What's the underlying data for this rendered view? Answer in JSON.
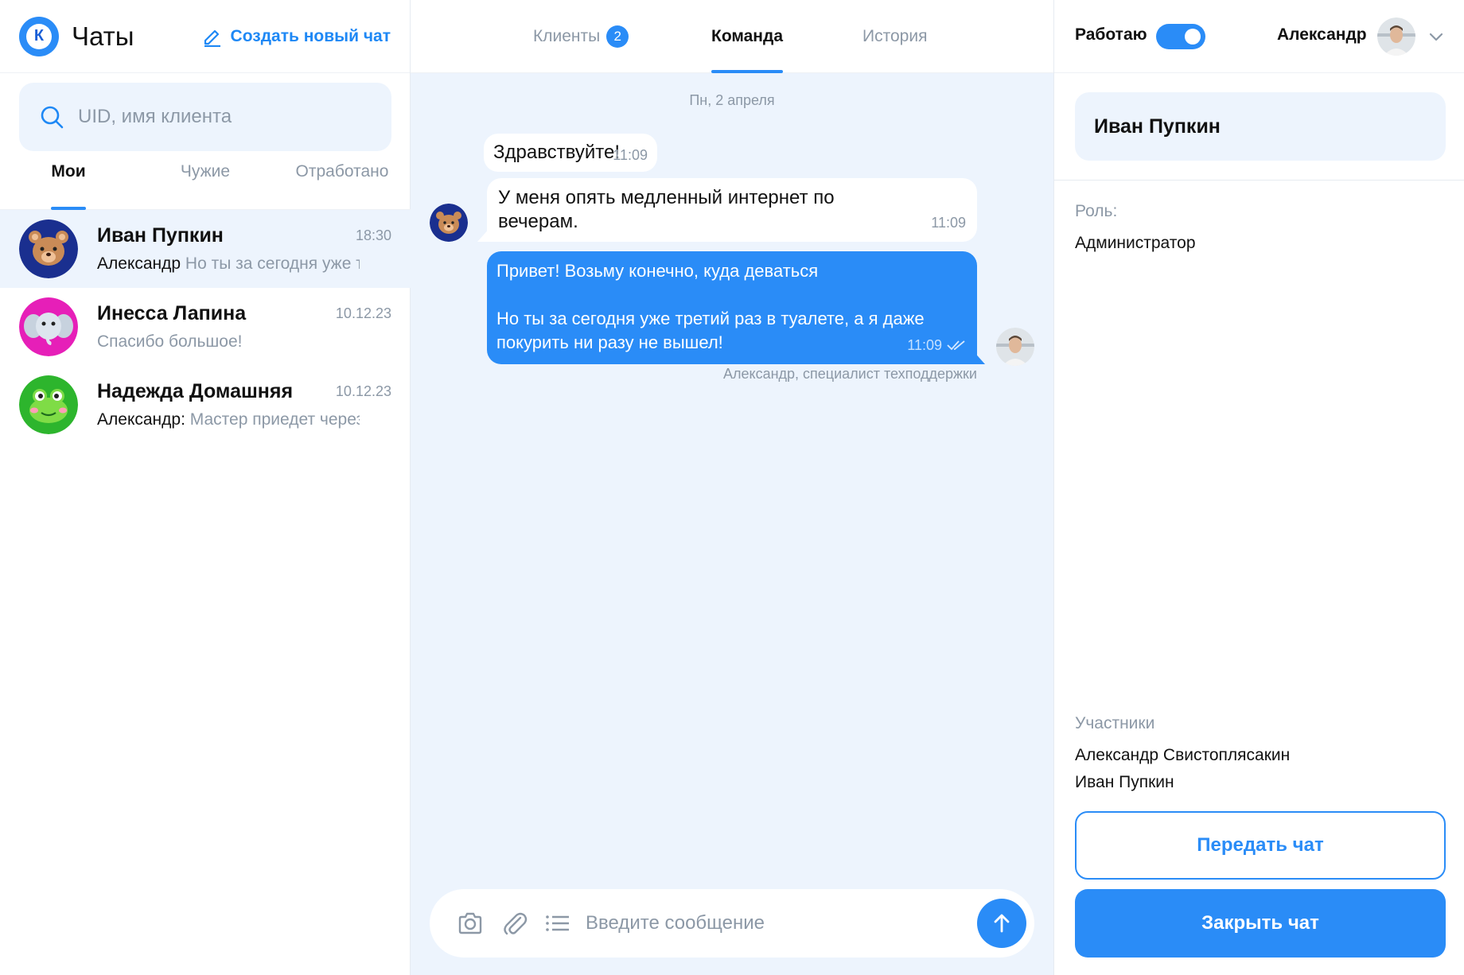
{
  "app": {
    "title": "Чаты",
    "logo_letter": "К",
    "create_chat_label": "Создать новый чат"
  },
  "search": {
    "placeholder": "UID, имя клиента",
    "value": ""
  },
  "left_tabs": [
    {
      "label": "Мои",
      "active": true
    },
    {
      "label": "Чужие",
      "active": false
    },
    {
      "label": "Отработано",
      "active": false
    }
  ],
  "chats": [
    {
      "name": "Иван Пупкин",
      "time": "18:30",
      "author": "Александр",
      "preview": "Но ты за сегодня уже третий раз в туалете",
      "avatar_icon": "bear-avatar-icon",
      "active": true
    },
    {
      "name": "Инесса Лапина",
      "time": "10.12.23",
      "author": "",
      "preview": "Спасибо большое!",
      "avatar_icon": "elephant-avatar-icon",
      "active": false
    },
    {
      "name": "Надежда Домашняя",
      "time": "10.12.23",
      "author": "Александр:",
      "preview": "Мастер приедет через час",
      "avatar_icon": "frog-avatar-icon",
      "active": false
    }
  ],
  "center_tabs": [
    {
      "label": "Клиенты",
      "badge": "2",
      "active": false
    },
    {
      "label": "Команда",
      "active": true
    },
    {
      "label": "История",
      "active": false
    }
  ],
  "conversation": {
    "date": "Пн, 2 апреля",
    "messages": [
      {
        "from": "client",
        "text": "Здравствуйте!",
        "time": "11:09"
      },
      {
        "from": "client",
        "text": "У меня опять медленный интернет по вечерам.",
        "time": "11:09"
      },
      {
        "from": "operator",
        "text": "Привет! Возьму конечно, куда деваться\n\nНо ты за сегодня уже третий раз в туалете, а я даже покурить ни разу не вышел!",
        "time": "11:09",
        "status": "read"
      }
    ],
    "sender_caption": "Александр, специалист техподдержки"
  },
  "composer": {
    "placeholder": "Введите сообщение",
    "value": ""
  },
  "status": {
    "label": "Работаю",
    "on": true
  },
  "user": {
    "name": "Александр"
  },
  "client_panel": {
    "name": "Иван Пупкин",
    "role_label": "Роль:",
    "role_value": "Администратор",
    "participants_label": "Участники",
    "participants": [
      "Александр Свистоплясакин",
      "Иван Пупкин"
    ],
    "transfer_label": "Передать чат",
    "close_label": "Закрыть чат"
  },
  "colors": {
    "accent": "#2a8cf7",
    "panel_bg": "#edf4fd",
    "muted": "#8c98a6"
  }
}
